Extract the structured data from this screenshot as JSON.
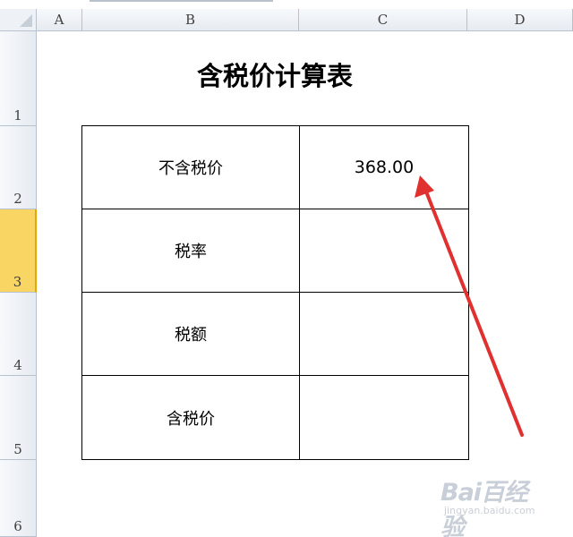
{
  "columns": [
    "A",
    "B",
    "C",
    "D"
  ],
  "rows": [
    "1",
    "2",
    "3",
    "4",
    "5",
    "6"
  ],
  "selected_row": "3",
  "sheet": {
    "title": "含税价计算表",
    "table": [
      {
        "label": "不含税价",
        "value": "368.00"
      },
      {
        "label": "税率",
        "value": ""
      },
      {
        "label": "税额",
        "value": ""
      },
      {
        "label": "含税价",
        "value": ""
      }
    ]
  },
  "annotation": {
    "arrow_color": "#e03030"
  },
  "watermark": {
    "logo": "Bai百经验",
    "sub": "jingyan.baidu.com"
  }
}
